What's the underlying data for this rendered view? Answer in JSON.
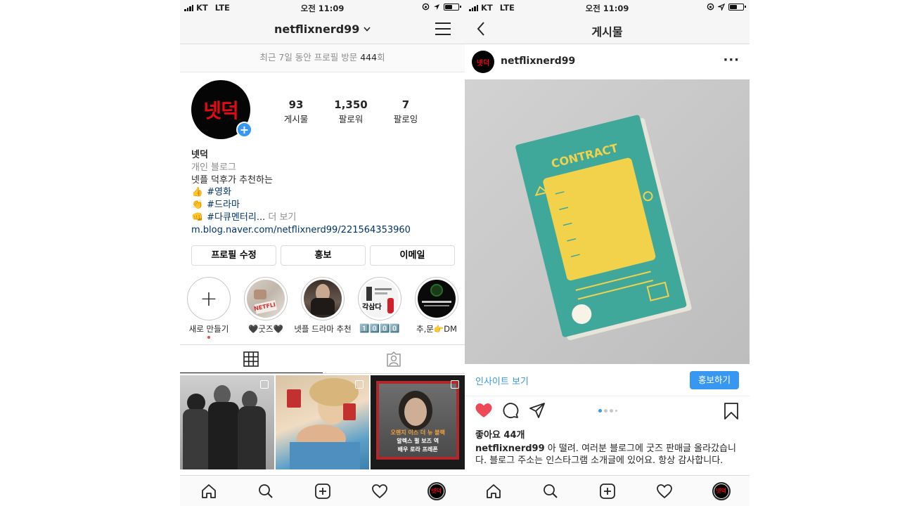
{
  "status": {
    "carrier": "KT",
    "network": "LTE",
    "time": "오전 11:09"
  },
  "profile": {
    "username": "netflixnerd99",
    "visits_text": "최근 7일 동안 프로필 방문 ",
    "visits_count": "444",
    "visits_suffix": "회",
    "avatar_text": "넷덕",
    "stats": [
      {
        "num": "93",
        "label": "게시물"
      },
      {
        "num": "1,350",
        "label": "팔로워"
      },
      {
        "num": "7",
        "label": "팔로잉"
      }
    ],
    "name": "넷덕",
    "category": "개인 블로그",
    "bio_line1": "넷플 덕후가 추천하는",
    "bio_items": [
      {
        "emoji": "👍",
        "tag": "#영화"
      },
      {
        "emoji": "👏",
        "tag": "#드라마"
      },
      {
        "emoji": "👊",
        "tag": "#다큐멘터리",
        "suffix": "...",
        "more": " 더 보기"
      }
    ],
    "link": "m.blog.naver.com/netflixnerd99/221564353960",
    "buttons": {
      "edit": "프로필 수정",
      "promote": "홍보",
      "email": "이메일"
    },
    "highlights": [
      {
        "label": "새로 만들기"
      },
      {
        "label": "🖤굿즈🖤"
      },
      {
        "label": "넷플 드라마 추천"
      },
      {
        "label": "1️⃣0️⃣0️⃣0️⃣"
      },
      {
        "label": "추,문👉DM"
      }
    ],
    "highlight_texts": {
      "netflix": "NETFLI",
      "gakdong": "각삼다"
    },
    "grid_text": {
      "line1": "오렌지 이스 더 뉴 블랙",
      "line2": "알렉스 펄 보즈 역",
      "line3": "배우 로라 프레폰"
    }
  },
  "post": {
    "header_title": "게시물",
    "username": "netflixnerd99",
    "avatar_text": "넷덕",
    "image_title": "CONTRACT",
    "insight": "인사이트 보기",
    "promote": "홍보하기",
    "likes": "좋아요 44개",
    "caption_user": "netflixnerd99",
    "caption_text": " 아 떨려. 여러분 블로그에 굿즈 판매글 올라갔습니다. 블로그 주소는 인스타그램 소개글에 있어요. 항상 감사합니다."
  },
  "colors": {
    "accent": "#3897f0",
    "brand_red": "#e50914",
    "like": "#ed4956"
  }
}
